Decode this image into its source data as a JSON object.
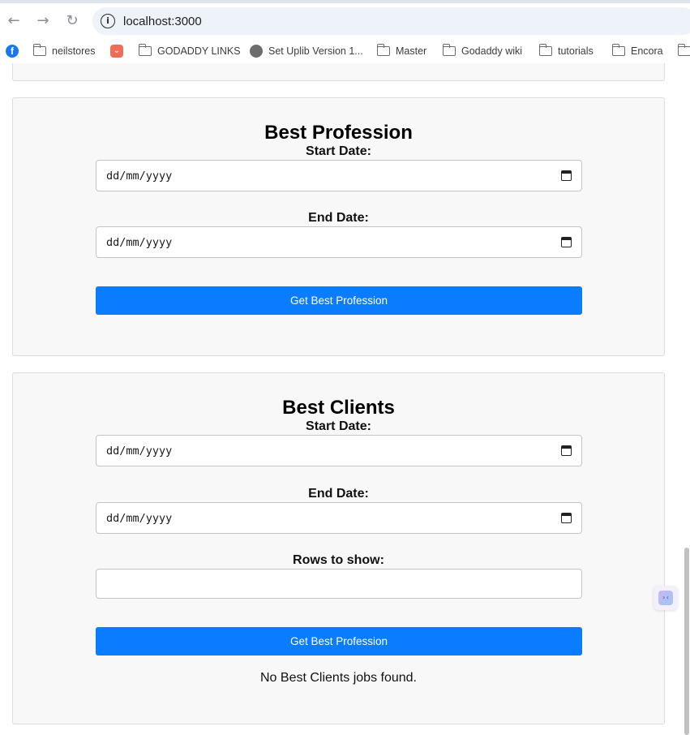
{
  "browser": {
    "url": "localhost:3000",
    "bookmarks": [
      {
        "label": "",
        "icon": "facebook-icon"
      },
      {
        "label": "neilstores",
        "icon": "folder-icon"
      },
      {
        "label": "",
        "icon": "pocket-icon"
      },
      {
        "label": "GODADDY LINKS",
        "icon": "folder-icon"
      },
      {
        "label": "Set Uplib Version 1...",
        "icon": "globe-icon"
      },
      {
        "label": "Master",
        "icon": "folder-icon"
      },
      {
        "label": "Godaddy wiki",
        "icon": "folder-icon"
      },
      {
        "label": "tutorials",
        "icon": "folder-icon"
      },
      {
        "label": "Encora",
        "icon": "folder-icon"
      },
      {
        "label": "",
        "icon": "folder-icon"
      }
    ]
  },
  "best_profession": {
    "title": "Best Profession",
    "start_label": "Start Date:",
    "start_placeholder": "dd/mm/yyyy",
    "end_label": "End Date:",
    "end_placeholder": "dd/mm/yyyy",
    "button": "Get Best Profession"
  },
  "best_clients": {
    "title": "Best Clients",
    "start_label": "Start Date:",
    "start_placeholder": "dd/mm/yyyy",
    "end_label": "End Date:",
    "end_placeholder": "dd/mm/yyyy",
    "rows_label": "Rows to show:",
    "rows_value": "",
    "button": "Get Best Profession",
    "result": "No Best Clients jobs found."
  },
  "colors": {
    "primary_button": "#0a7cff",
    "card_background": "#f8f8f8"
  }
}
